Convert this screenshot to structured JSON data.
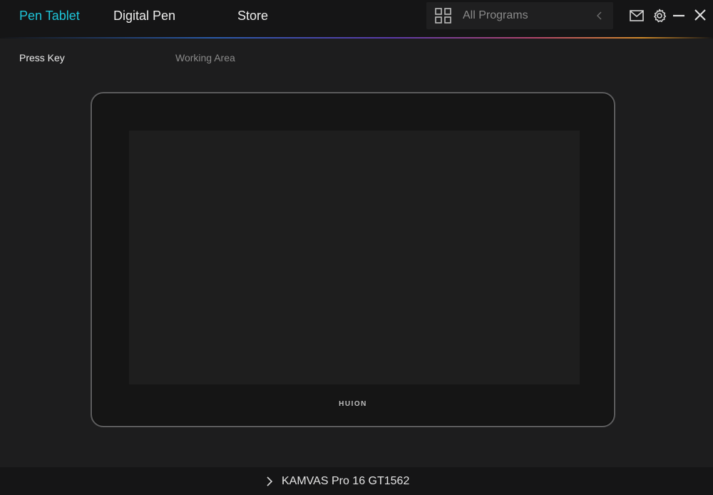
{
  "tabs": [
    {
      "label": "Pen Tablet",
      "active": true
    },
    {
      "label": "Digital Pen",
      "active": false
    },
    {
      "label": "Store",
      "active": false
    }
  ],
  "programs": {
    "label": "All Programs",
    "icon": "grid-icon",
    "collapse_icon": "chevron-left-icon"
  },
  "window_controls": [
    "mail-icon",
    "gear-icon",
    "minimize-icon",
    "close-icon"
  ],
  "subtabs": [
    {
      "label": "Press Key",
      "active": true
    },
    {
      "label": "Working Area",
      "active": false
    }
  ],
  "tablet": {
    "brand": "HUION"
  },
  "device": {
    "name": "KAMVAS Pro 16 GT1562",
    "expand_icon": "chevron-right-icon"
  },
  "colors": {
    "accent": "#1ec4d8",
    "background": "#1d1d1e",
    "bar": "#151516"
  }
}
